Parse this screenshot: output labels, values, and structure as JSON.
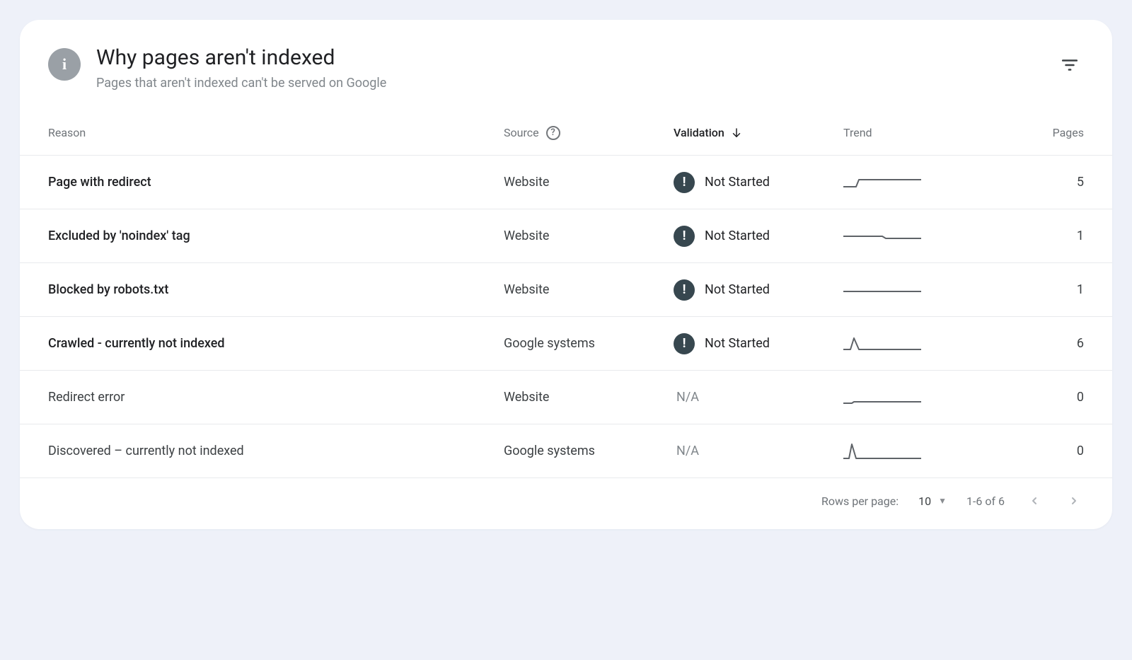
{
  "header": {
    "title": "Why pages aren't indexed",
    "subtitle": "Pages that aren't indexed can't be served on Google"
  },
  "columns": {
    "reason": "Reason",
    "source": "Source",
    "validation": "Validation",
    "trend": "Trend",
    "pages": "Pages"
  },
  "validation_labels": {
    "not_started": "Not Started",
    "na": "N/A"
  },
  "rows": [
    {
      "reason": "Page with redirect",
      "source": "Website",
      "validation": "not_started",
      "pages": 5,
      "trend": "step"
    },
    {
      "reason": "Excluded by 'noindex' tag",
      "source": "Website",
      "validation": "not_started",
      "pages": 1,
      "trend": "dip"
    },
    {
      "reason": "Blocked by robots.txt",
      "source": "Website",
      "validation": "not_started",
      "pages": 1,
      "trend": "flat"
    },
    {
      "reason": "Crawled - currently not indexed",
      "source": "Google systems",
      "validation": "not_started",
      "pages": 6,
      "trend": "spike"
    },
    {
      "reason": "Redirect error",
      "source": "Website",
      "validation": "na",
      "pages": 0,
      "trend": "low"
    },
    {
      "reason": "Discovered – currently not indexed",
      "source": "Google systems",
      "validation": "na",
      "pages": 0,
      "trend": "spike2"
    }
  ],
  "pager": {
    "rows_label": "Rows per page:",
    "rows_value": "10",
    "range": "1-6 of 6"
  },
  "icons": {
    "info": "i",
    "help": "?",
    "warn": "!"
  }
}
